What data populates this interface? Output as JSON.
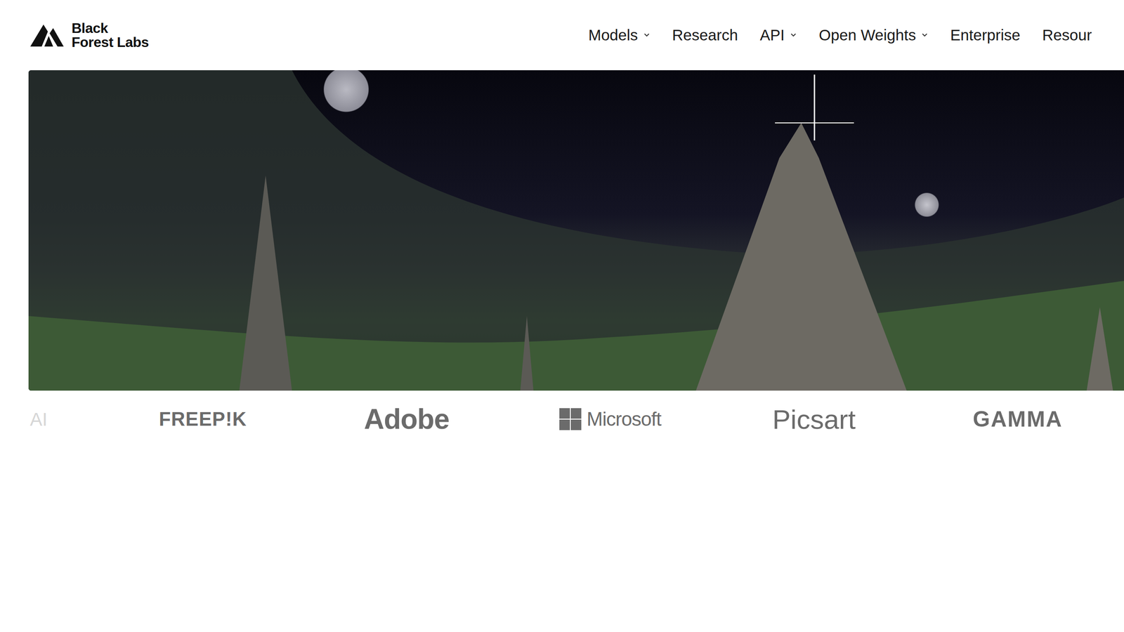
{
  "brand": {
    "line1": "Black",
    "line2": "Forest Labs"
  },
  "nav": [
    {
      "label": "Models",
      "dropdown": true
    },
    {
      "label": "Research",
      "dropdown": false
    },
    {
      "label": "API",
      "dropdown": true
    },
    {
      "label": "Open Weights",
      "dropdown": true
    },
    {
      "label": "Enterprise",
      "dropdown": false
    },
    {
      "label": "Resour",
      "dropdown": false
    }
  ],
  "logos": [
    {
      "label": "AI",
      "kind": "text"
    },
    {
      "label": "FREEP!K",
      "kind": "text"
    },
    {
      "label": "Adobe",
      "kind": "text"
    },
    {
      "label": "Microsoft",
      "kind": "windows"
    },
    {
      "label": "Picsart",
      "kind": "text"
    },
    {
      "label": "GAMMA",
      "kind": "text"
    }
  ]
}
